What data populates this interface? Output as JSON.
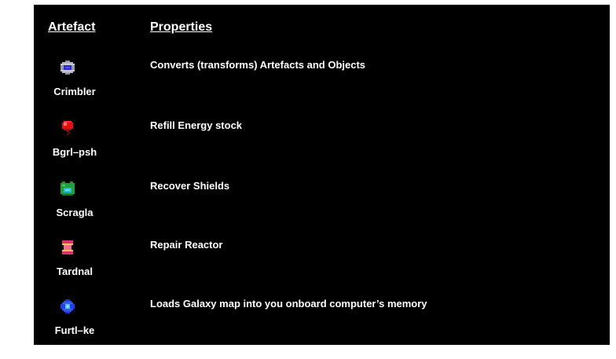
{
  "headers": {
    "artefact": "Artefact",
    "properties": "Properties"
  },
  "rows": [
    {
      "name": "Crimbler",
      "property": "Converts (transforms) Artefacts and Objects",
      "icon": "crimbler-icon"
    },
    {
      "name": "Bgrl–psh",
      "property": "Refill Energy stock",
      "icon": "bgrl-psh-icon"
    },
    {
      "name": "Scragla",
      "property": "Recover Shields",
      "icon": "scragla-icon"
    },
    {
      "name": "Tardnal",
      "property": "Repair Reactor",
      "icon": "tardnal-icon"
    },
    {
      "name": "Furtl–ke",
      "property": "Loads Galaxy map into you onboard computer’s memory",
      "icon": "furtl-ke-icon"
    }
  ],
  "colors": {
    "background": "#000000",
    "text": "#ffffff"
  }
}
